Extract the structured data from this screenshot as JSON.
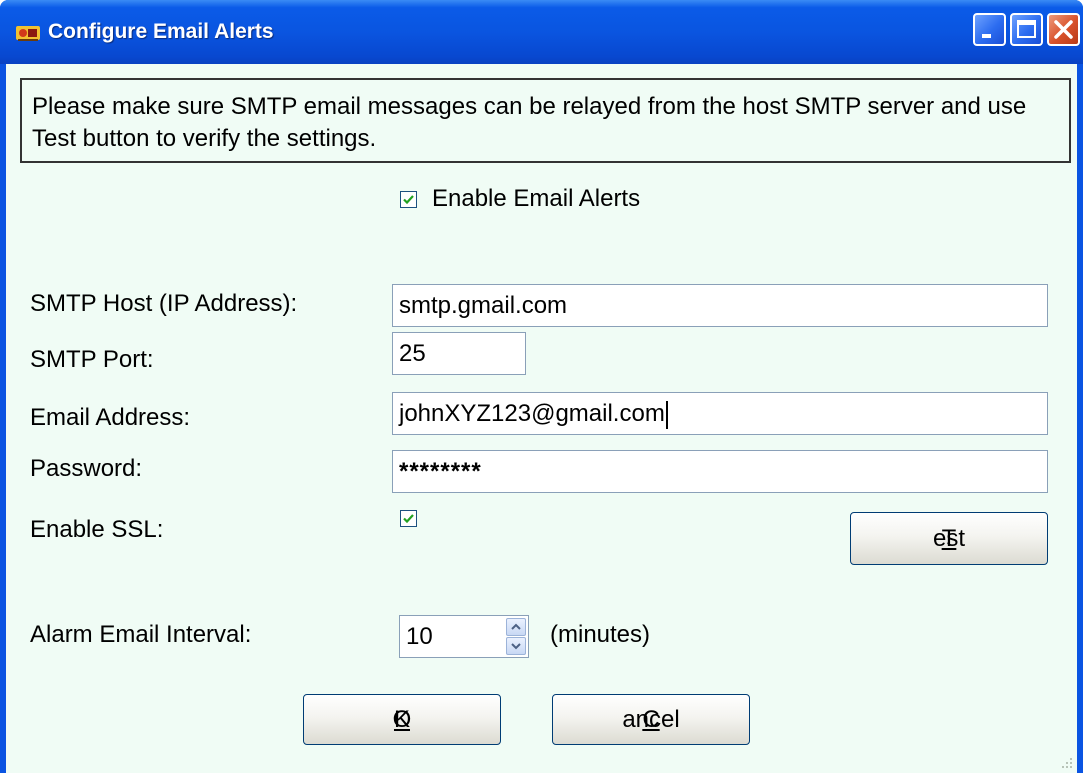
{
  "window": {
    "title": "Configure Email Alerts"
  },
  "notice": {
    "text": "Please make sure SMTP email messages can be relayed from the host SMTP server and use Test button to verify the settings."
  },
  "enable_alerts": {
    "label": "Enable Email Alerts",
    "checked": true
  },
  "fields": {
    "smtp_host": {
      "label": "SMTP Host (IP Address):",
      "value": "smtp.gmail.com"
    },
    "smtp_port": {
      "label": "SMTP Port:",
      "value": "25"
    },
    "email": {
      "label": "Email Address:",
      "value": "johnXYZ123@gmail.com"
    },
    "password": {
      "label": "Password:",
      "value": "********"
    },
    "ssl": {
      "label": "Enable SSL:",
      "checked": true
    }
  },
  "interval": {
    "label": "Alarm Email Interval:",
    "value": "10",
    "unit": "(minutes)"
  },
  "buttons": {
    "test": {
      "mnemonic": "T",
      "rest": "est"
    },
    "ok": {
      "pre": "O",
      "mnemonic": "K"
    },
    "cancel": {
      "mnemonic": "C",
      "rest": "ancel"
    }
  },
  "colors": {
    "titlebar": "#0a55e0",
    "client_bg": "#f0fcf5",
    "check_mark": "#21a121"
  }
}
